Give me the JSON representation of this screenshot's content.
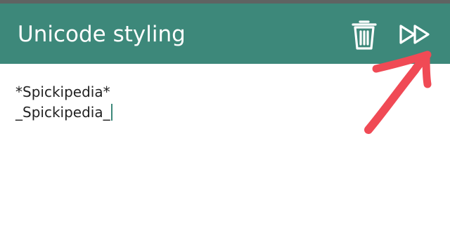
{
  "app_bar": {
    "title": "Unicode styling",
    "background_color": "#3d887a",
    "actions": [
      {
        "icon": "trash-icon",
        "action": "delete"
      },
      {
        "icon": "fast-forward-icon",
        "action": "forward"
      }
    ]
  },
  "editor": {
    "lines": [
      "*Spickipedia*",
      "_Spickipedia_"
    ],
    "caret_color": "#3d887a"
  },
  "annotation": {
    "type": "hand-drawn-arrow",
    "color": "#f04a55",
    "points_to": "fast-forward-icon"
  }
}
